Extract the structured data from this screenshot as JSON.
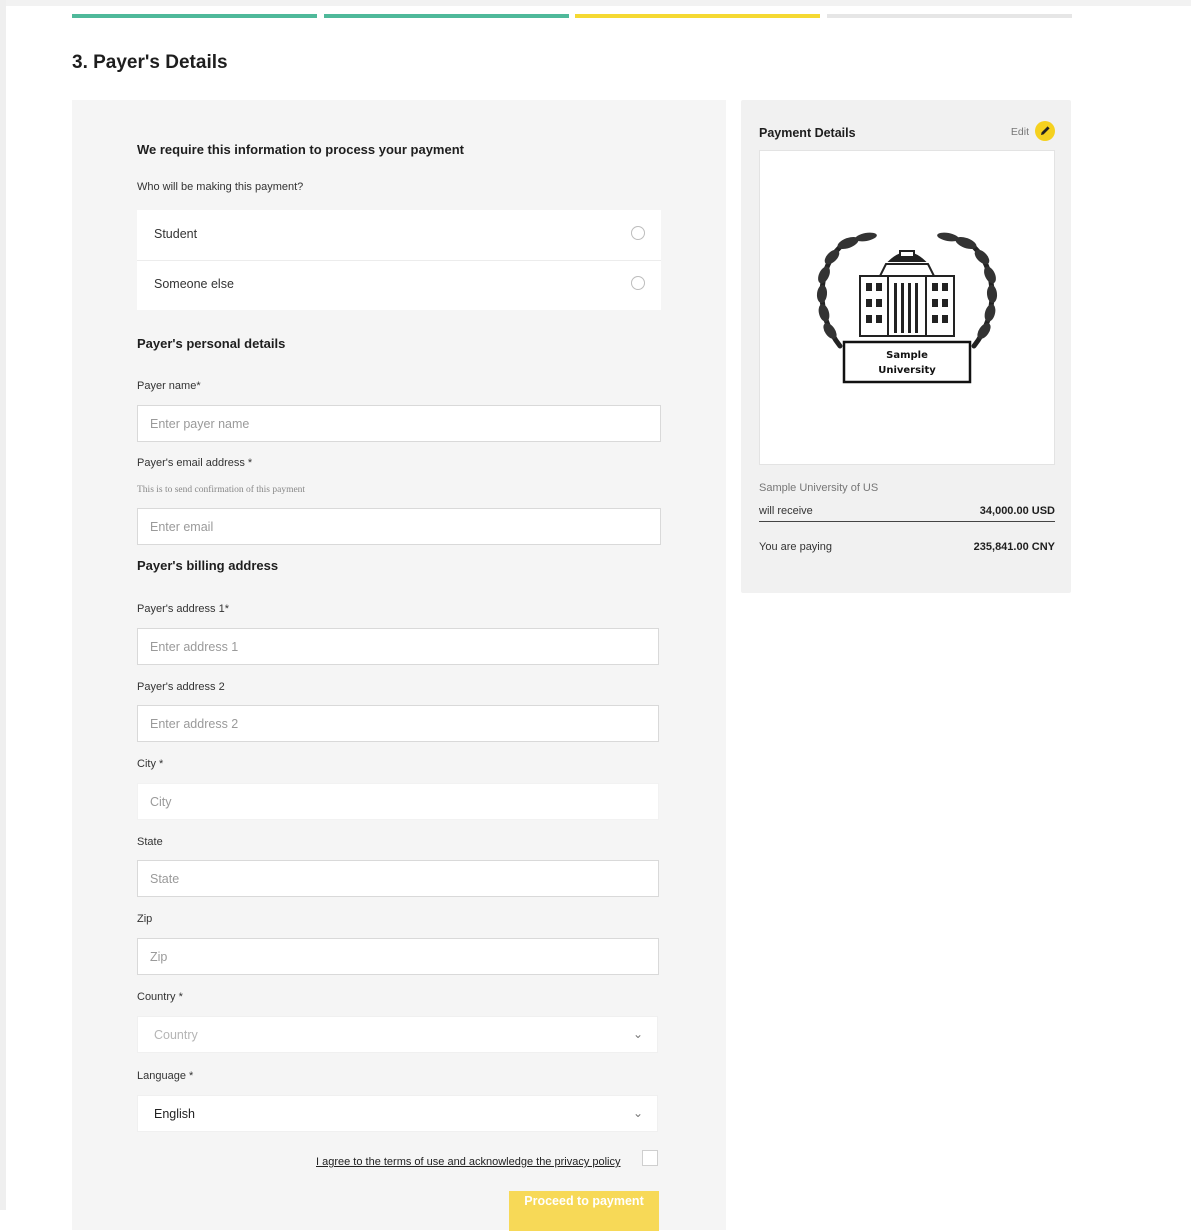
{
  "progress": {
    "steps": [
      {
        "state": "complete",
        "color": "#4fb99a"
      },
      {
        "state": "complete",
        "color": "#4fb99a"
      },
      {
        "state": "current",
        "color": "#f5d932"
      },
      {
        "state": "upcoming",
        "color": "#e6e6e6"
      }
    ]
  },
  "page": {
    "title": "3. Payer's Details"
  },
  "form": {
    "intro": "We require this information to process your payment",
    "question": "Who will be making this payment?",
    "payer_options": [
      "Student",
      "Someone else"
    ],
    "personal_title": "Payer's personal details",
    "payer_name": {
      "label": "Payer name",
      "required_mark": "*",
      "placeholder": "Enter payer name"
    },
    "email": {
      "label": "Payer's email address",
      "required_mark": " *",
      "hint": "This is to send confirmation of this payment",
      "placeholder": "Enter email"
    },
    "billing_title": "Payer's billing address",
    "address1": {
      "label": "Payer's address 1",
      "required_mark": "*",
      "placeholder": "Enter address 1"
    },
    "address2": {
      "label": "Payer's address 2",
      "placeholder": "Enter address 2"
    },
    "city": {
      "label": "City",
      "required_mark": " *",
      "placeholder": "City"
    },
    "state": {
      "label": "State",
      "placeholder": "State"
    },
    "zip": {
      "label": "Zip",
      "placeholder": "Zip"
    },
    "country": {
      "label": "Country",
      "required_mark": " *",
      "placeholder": "Country"
    },
    "language": {
      "label": "Language",
      "required_mark": " *",
      "value": "English"
    },
    "terms_text": "I agree to the terms of use and acknowledge the privacy policy",
    "proceed_label": "Proceed to payment"
  },
  "summary": {
    "title": "Payment Details",
    "edit_label": "Edit",
    "logo_text": [
      "Sample",
      "University"
    ],
    "recipient": "Sample University of US",
    "will_receive_label": "will receive",
    "will_receive_amount": "34,000.00 USD",
    "paying_label": "You are paying",
    "paying_amount": "235,841.00 CNY"
  },
  "colors": {
    "accent": "#f5d932",
    "progress_done": "#4fb99a",
    "button": "#f7d957"
  }
}
